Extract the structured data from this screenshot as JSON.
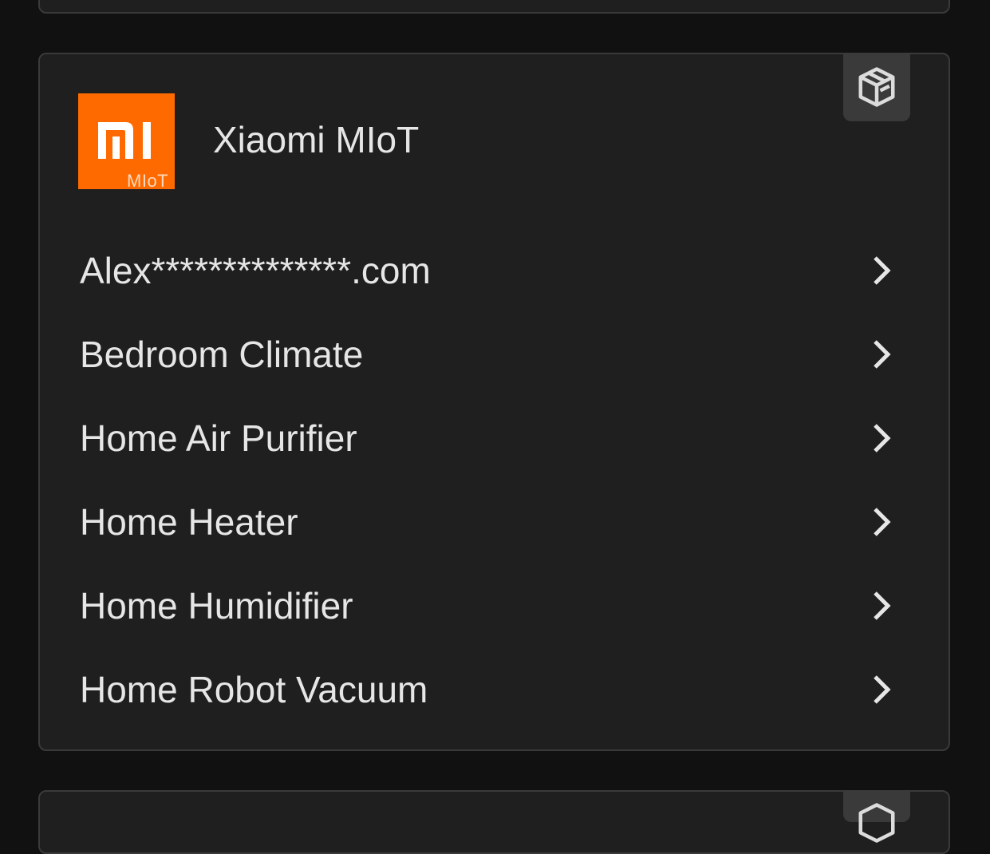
{
  "integration": {
    "title": "Xiaomi MIoT",
    "logo_text": "MI",
    "logo_subtext": "MIoT",
    "brand_color": "#ff6a00",
    "badge_icon": "package-icon"
  },
  "entries": [
    {
      "label": "Alex**************.com"
    },
    {
      "label": "Bedroom Climate"
    },
    {
      "label": "Home Air Purifier"
    },
    {
      "label": "Home Heater"
    },
    {
      "label": "Home Humidifier"
    },
    {
      "label": "Home Robot Vacuum"
    }
  ],
  "colors": {
    "background": "#111111",
    "card": "#1f1f1f",
    "card_border": "#3a3a3a",
    "text": "#e6e6e6"
  }
}
